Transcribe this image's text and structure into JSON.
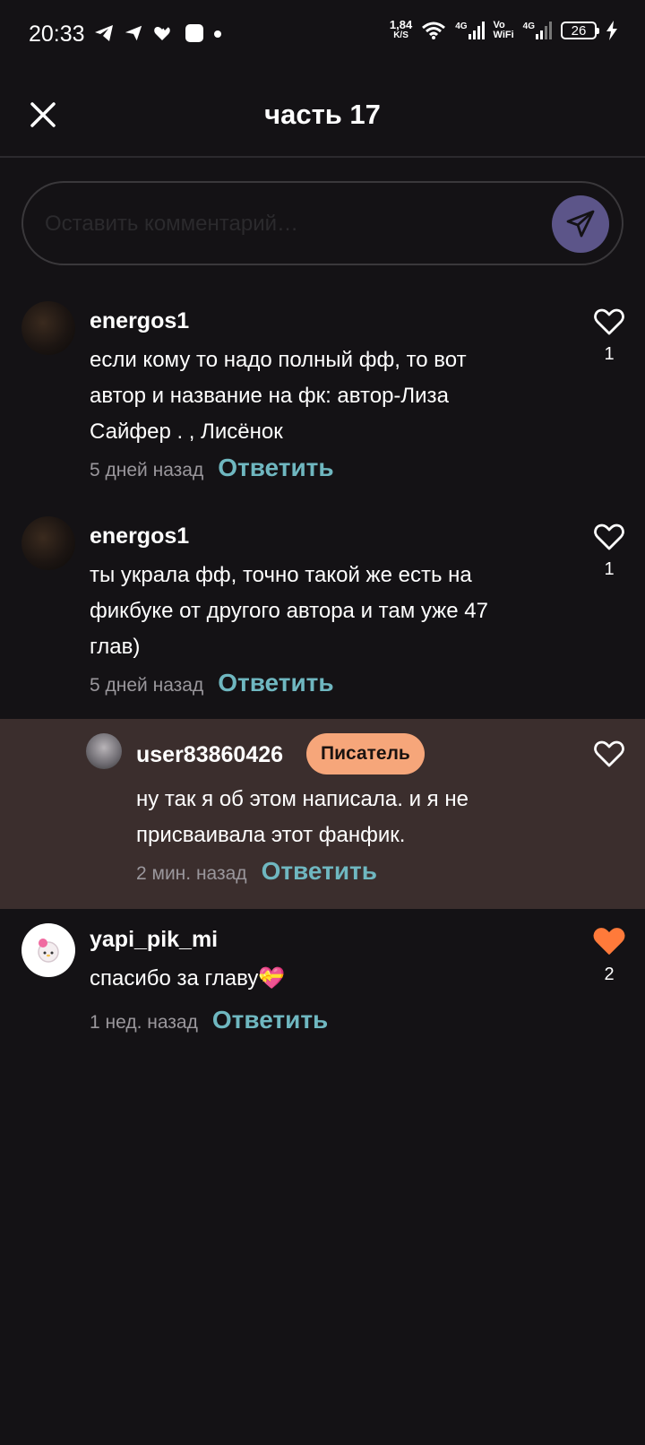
{
  "status_bar": {
    "time": "20:33",
    "net_speed_value": "1,84",
    "net_speed_unit": "K/S",
    "sig1_label": "4G",
    "volte_top": "Vo",
    "volte_bottom": "WiFi",
    "sig2_label": "4G",
    "battery": "26"
  },
  "header": {
    "title": "часть 17"
  },
  "compose": {
    "placeholder": "Оставить комментарий…"
  },
  "comments": [
    {
      "username": "energos1",
      "lines": [
        "если кому то надо полный фф, то вот",
        "автор и название на фк: автор-Лиза",
        "Сайфер . , Лисёнок"
      ],
      "time": "5 дней назад",
      "reply": "Ответить",
      "likes": "1",
      "liked": false
    },
    {
      "username": "energos1",
      "lines": [
        "ты украла фф, точно такой же есть на",
        "фикбуке от другого автора и там уже 47",
        "глав)"
      ],
      "time": "5 дней назад",
      "reply": "Ответить",
      "likes": "1",
      "liked": false
    },
    {
      "username": "user83860426",
      "badge": "Писатель",
      "lines": [
        "ну так я об этом написала. и я не",
        "присваивала этот фанфик."
      ],
      "time": "2 мин. назад",
      "reply": "Ответить",
      "liked": false
    },
    {
      "username": "yapi_pik_mi",
      "lines": [
        "спасибо за главу💝"
      ],
      "time": "1 нед. назад",
      "reply": "Ответить",
      "likes": "2",
      "liked": true
    }
  ],
  "colors": {
    "background": "#141215",
    "accent_reply": "#6fb7c0",
    "send_button": "#5c5589",
    "writer_badge": "#f6a67a",
    "liked_heart": "#ff7a3a",
    "highlight_row": "#3b2e2d"
  },
  "icons": {
    "close": "close-icon",
    "send": "send-icon",
    "like": "heart-icon"
  }
}
